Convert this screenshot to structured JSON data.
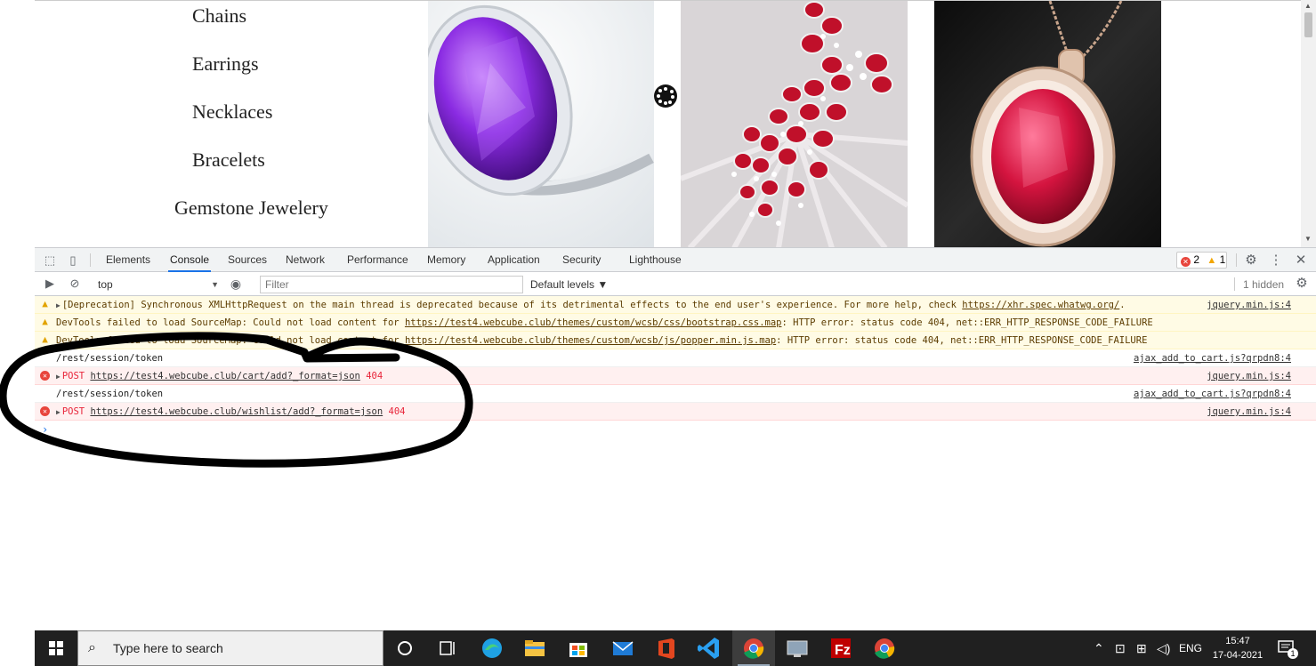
{
  "page": {
    "categories": [
      "Chains",
      "Earrings",
      "Necklaces",
      "Bracelets",
      "Gemstone Jewelery"
    ],
    "products": [
      "amethyst-ring",
      "ruby-necklace",
      "ruby-pendant"
    ]
  },
  "devtools": {
    "tabs": [
      "Elements",
      "Console",
      "Sources",
      "Network",
      "Performance",
      "Memory",
      "Application",
      "Security",
      "Lighthouse"
    ],
    "active_tab": "Console",
    "error_count": "2",
    "warning_count": "1",
    "context": "top",
    "filter_placeholder": "Filter",
    "levels": "Default levels",
    "hidden": "1 hidden",
    "messages": [
      {
        "level": "warning",
        "prefix": "[Deprecation] Synchronous XMLHttpRequest on the main thread is deprecated because of its detrimental effects to the end user's experience. For more help, check ",
        "link": "https://xhr.spec.whatwg.org/",
        "suffix": ".",
        "source": "jquery.min.js:4"
      },
      {
        "level": "warning",
        "prefix": "DevTools failed to load SourceMap: Could not load content for ",
        "link": "https://test4.webcube.club/themes/custom/wcsb/css/bootstrap.css.map",
        "suffix": ": HTTP error: status code 404, net::ERR_HTTP_RESPONSE_CODE_FAILURE",
        "source": ""
      },
      {
        "level": "warning",
        "prefix": "DevTools failed to load SourceMap: Could not load content for ",
        "link": "https://test4.webcube.club/themes/custom/wcsb/js/popper.min.js.map",
        "suffix": ": HTTP error: status code 404, net::ERR_HTTP_RESPONSE_CODE_FAILURE",
        "source": ""
      },
      {
        "level": "log",
        "prefix": "/rest/session/token",
        "link": "",
        "suffix": "",
        "source": "ajax_add_to_cart.js?qrpdn8:4"
      },
      {
        "level": "error",
        "prefix": "POST ",
        "link": "https://test4.webcube.club/cart/add?_format=json",
        "suffix": " 404",
        "source": "jquery.min.js:4"
      },
      {
        "level": "log",
        "prefix": "/rest/session/token",
        "link": "",
        "suffix": "",
        "source": "ajax_add_to_cart.js?qrpdn8:4"
      },
      {
        "level": "error",
        "prefix": "POST ",
        "link": "https://test4.webcube.club/wishlist/add?_format=json",
        "suffix": " 404",
        "source": "jquery.min.js:4"
      }
    ],
    "prompt": "›"
  },
  "taskbar": {
    "search_placeholder": "Type here to search",
    "apps": [
      "cortana",
      "task-view",
      "edge",
      "file-explorer",
      "store",
      "mail",
      "office",
      "vscode",
      "chrome",
      "remote-desktop",
      "filezilla",
      "chrome"
    ],
    "language": "ENG",
    "time": "15:47",
    "date": "17-04-2021",
    "notification_count": "1"
  },
  "colors": {
    "accent": "#1a73e8",
    "error": "#e8453c",
    "warning": "#f2a600",
    "taskbar": "#202020"
  }
}
